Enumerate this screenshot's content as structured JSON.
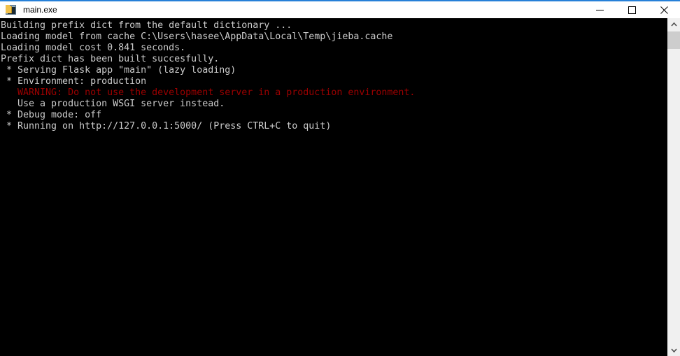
{
  "window": {
    "title": "main.exe",
    "icon": "console-app-icon",
    "accent_color": "#2680d8",
    "titlebar_background": "#ffffff",
    "console_background": "#000000",
    "console_foreground": "#cccccc",
    "warning_color": "#9d0000"
  },
  "window_controls": {
    "minimize_label": "Minimize",
    "maximize_label": "Maximize",
    "close_label": "Close"
  },
  "console": {
    "lines": [
      {
        "text": "Building prefix dict from the default dictionary ...",
        "color": "normal"
      },
      {
        "text": "Loading model from cache C:\\Users\\hasee\\AppData\\Local\\Temp\\jieba.cache",
        "color": "normal"
      },
      {
        "text": "Loading model cost 0.841 seconds.",
        "color": "normal"
      },
      {
        "text": "Prefix dict has been built succesfully.",
        "color": "normal"
      },
      {
        "text": " * Serving Flask app \"main\" (lazy loading)",
        "color": "normal"
      },
      {
        "text": " * Environment: production",
        "color": "normal"
      },
      {
        "text": "   WARNING: Do not use the development server in a production environment.",
        "color": "red"
      },
      {
        "text": "   Use a production WSGI server instead.",
        "color": "normal"
      },
      {
        "text": " * Debug mode: off",
        "color": "normal"
      },
      {
        "text": " * Running on http://127.0.0.1:5000/ (Press CTRL+C to quit)",
        "color": "normal"
      }
    ]
  },
  "scrollbar": {
    "up_arrow": "chevron-up-icon",
    "down_arrow": "chevron-down-icon",
    "thumb_position_percent": 0,
    "thumb_size_percent": 5
  }
}
